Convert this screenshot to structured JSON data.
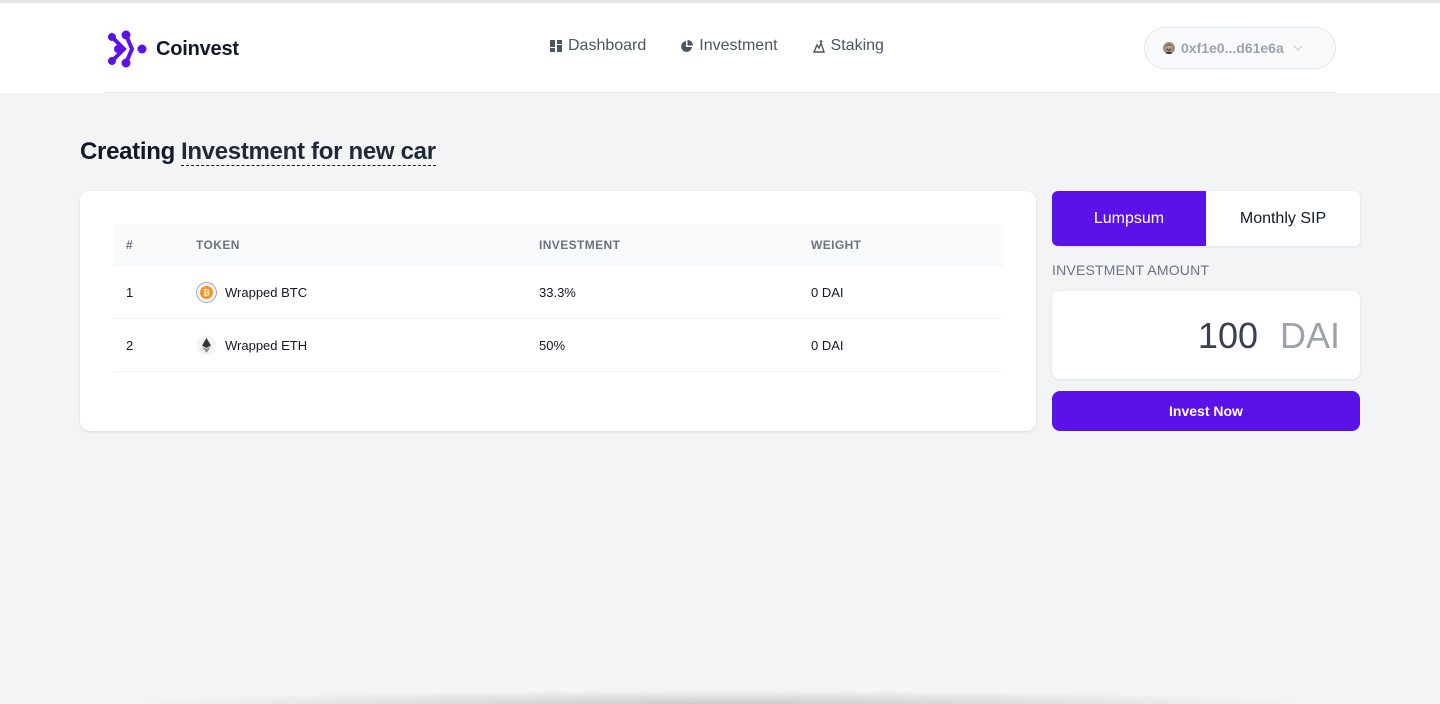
{
  "brand": {
    "name": "Coinvest",
    "accent": "#5b12e8"
  },
  "nav": {
    "items": [
      {
        "label": "Dashboard",
        "icon": "grid-icon"
      },
      {
        "label": "Investment",
        "icon": "pie-chart-icon"
      },
      {
        "label": "Staking",
        "icon": "staking-icon"
      }
    ]
  },
  "wallet": {
    "address": "0xf1e0...d61e6a"
  },
  "page": {
    "title_prefix": "Creating",
    "title_name": "Investment for new car"
  },
  "table": {
    "headers": [
      "#",
      "TOKEN",
      "INVESTMENT",
      "WEIGHT"
    ],
    "rows": [
      {
        "index": "1",
        "token": "Wrapped BTC",
        "icon": "bitcoin-icon",
        "investment": "33.3%",
        "weight": "0 DAI"
      },
      {
        "index": "2",
        "token": "Wrapped ETH",
        "icon": "ethereum-icon",
        "investment": "50%",
        "weight": "0 DAI"
      }
    ]
  },
  "sidebar": {
    "tabs": [
      {
        "label": "Lumpsum",
        "active": true
      },
      {
        "label": "Monthly SIP",
        "active": false
      }
    ],
    "amount_label": "INVESTMENT AMOUNT",
    "amount_value": "100",
    "amount_unit": "DAI",
    "invest_label": "Invest Now"
  }
}
